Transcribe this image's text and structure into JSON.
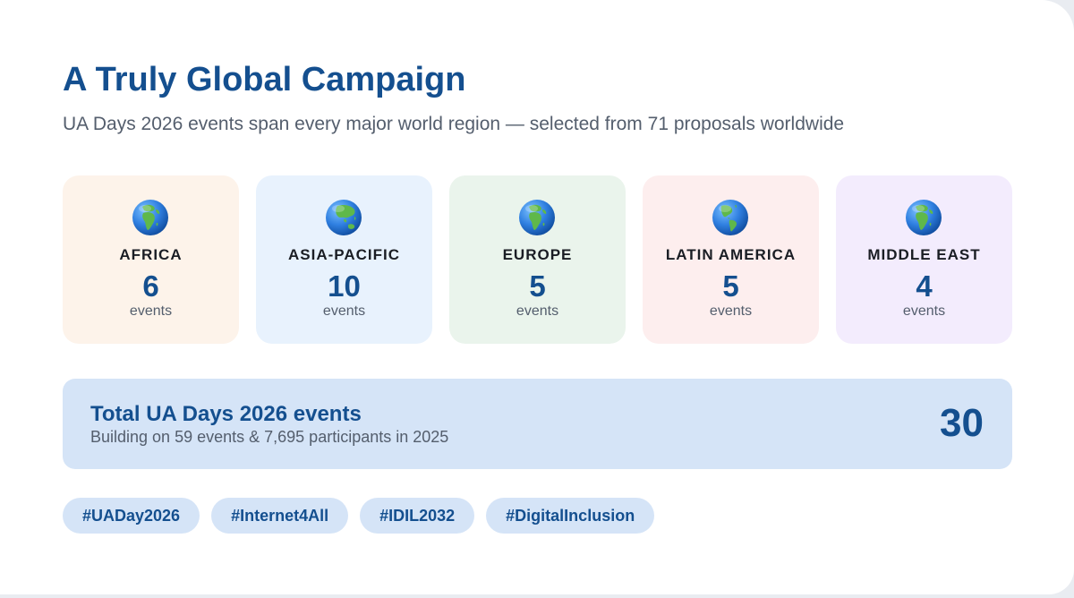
{
  "header": {
    "title": "A Truly Global Campaign",
    "subtitle": "UA Days 2026 events span every major world region — selected from 71 proposals worldwide"
  },
  "regions": [
    {
      "name": "AFRICA",
      "count": "6",
      "unit": "events",
      "icon": "globe-icon",
      "bg": "#fdf3ea",
      "view": "africa"
    },
    {
      "name": "ASIA-PACIFIC",
      "count": "10",
      "unit": "events",
      "icon": "globe-icon",
      "bg": "#e8f2fd",
      "view": "asia"
    },
    {
      "name": "EUROPE",
      "count": "5",
      "unit": "events",
      "icon": "globe-icon",
      "bg": "#eaf4ec",
      "view": "africa"
    },
    {
      "name": "LATIN AMERICA",
      "count": "5",
      "unit": "events",
      "icon": "globe-icon",
      "bg": "#fdeeee",
      "view": "americas"
    },
    {
      "name": "MIDDLE EAST",
      "count": "4",
      "unit": "events",
      "icon": "globe-icon",
      "bg": "#f3ecfd",
      "view": "africa"
    }
  ],
  "total": {
    "label": "Total UA Days 2026 events",
    "note": "Building on 59 events & 7,695 participants in 2025",
    "value": "30",
    "bg": "#d5e4f7"
  },
  "tags": [
    "#UADay2026",
    "#Internet4All",
    "#IDIL2032",
    "#DigitalInclusion"
  ],
  "colors": {
    "accent": "#144f8f",
    "muted_text": "#545e6d",
    "globe_ocean": "#2f7fe0",
    "globe_land": "#5fb84a"
  }
}
